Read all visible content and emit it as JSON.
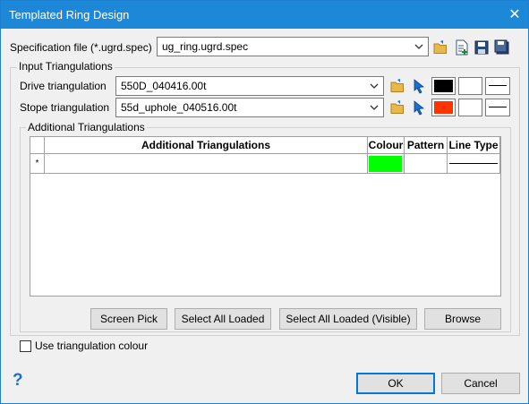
{
  "window": {
    "title": "Templated Ring Design",
    "close_glyph": "✕"
  },
  "spec": {
    "label": "Specification file (*.ugrd.spec)",
    "value": "ug_ring.ugrd.spec"
  },
  "input_triangulations": {
    "legend": "Input Triangulations",
    "drive": {
      "label": "Drive triangulation",
      "value": "550D_040416.00t",
      "colour": "#000000"
    },
    "stope": {
      "label": "Stope triangulation",
      "value": "55d_uphole_040516.00t",
      "colour": "#ff3300"
    }
  },
  "additional": {
    "legend": "Additional Triangulations",
    "columns": [
      "Additional Triangulations",
      "Colour",
      "Pattern",
      "Line Type"
    ],
    "new_row_marker": "*",
    "new_row_colour": "#00ff00"
  },
  "buttons": {
    "screen_pick": "Screen Pick",
    "select_all_loaded": "Select All Loaded",
    "select_all_loaded_visible": "Select All Loaded (Visible)",
    "browse": "Browse",
    "ok": "OK",
    "cancel": "Cancel"
  },
  "use_triangulation_colour": {
    "label": "Use triangulation colour",
    "checked": false
  },
  "help_glyph": "?"
}
